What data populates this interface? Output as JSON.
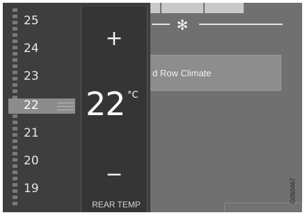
{
  "background": {
    "climate_button_label": "d Row Climate",
    "fan_icon": "fan-icon"
  },
  "scale": {
    "numbers": [
      "25",
      "24",
      "23",
      "22",
      "21",
      "20",
      "19"
    ],
    "selected": "22"
  },
  "control": {
    "increase_label": "+",
    "decrease_label": "−",
    "temperature": "22",
    "unit": "°C",
    "zone_label": "REAR  TEMP"
  },
  "figure_code": "G060467",
  "colors": {
    "overlay": "#3e3e3e",
    "control_panel": "#353535",
    "screen_background": "#707070",
    "text": "#ffffff"
  }
}
